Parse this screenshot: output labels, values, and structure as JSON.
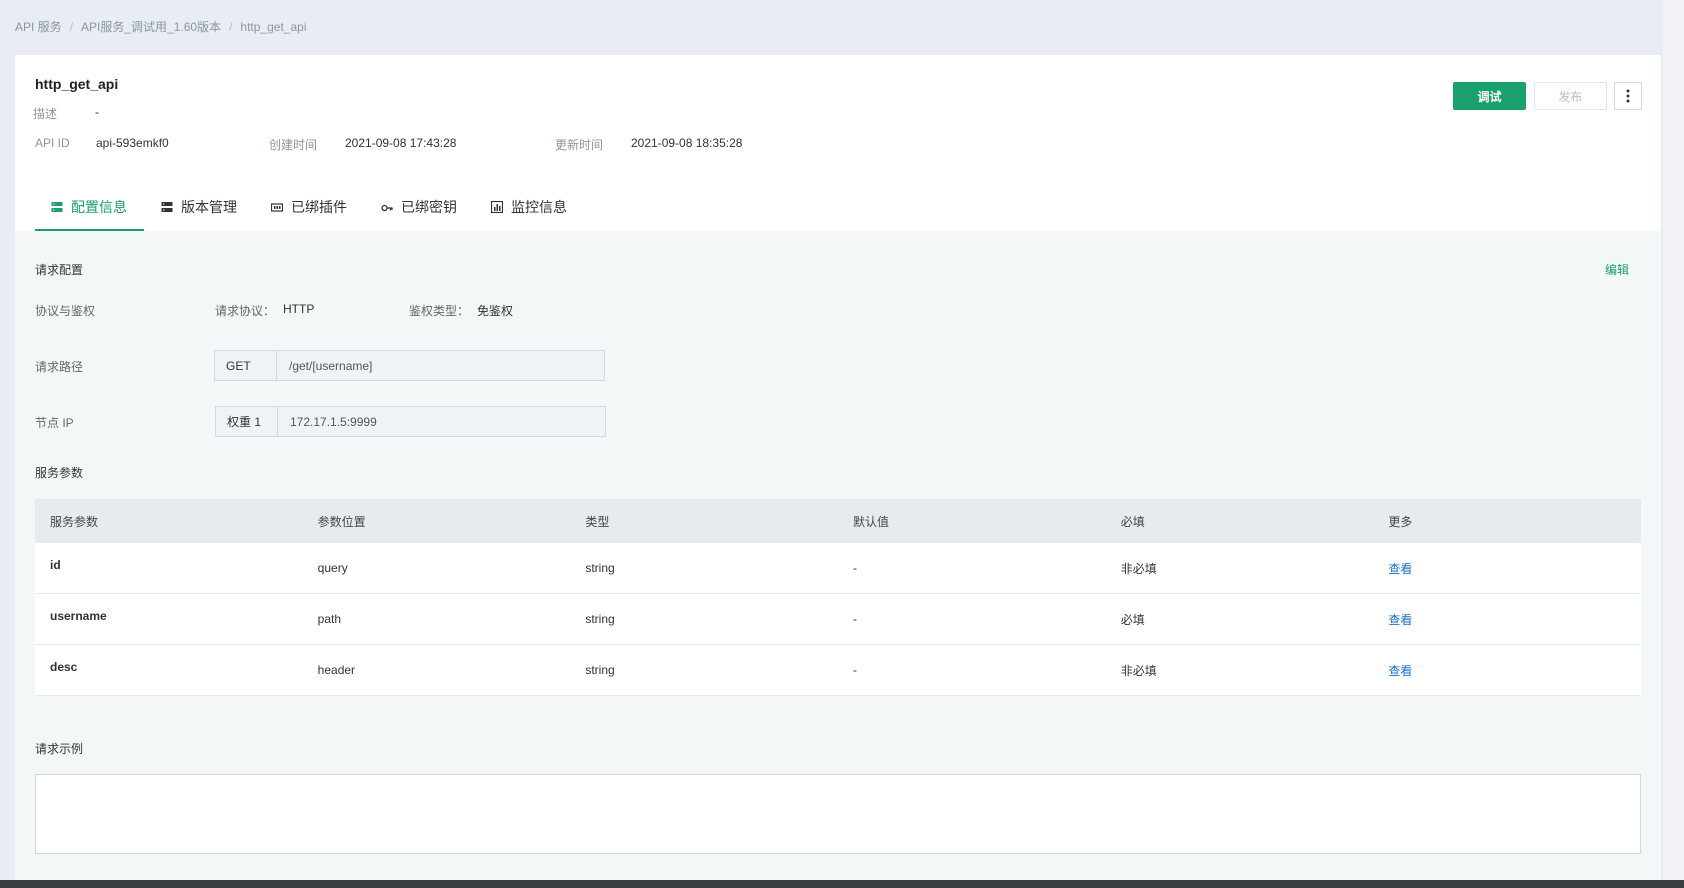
{
  "breadcrumb": {
    "items": [
      "API 服务",
      "API服务_调试用_1.60版本",
      "http_get_api"
    ],
    "separator": "/"
  },
  "header": {
    "title": "http_get_api",
    "desc_label": "描述",
    "desc_value": "-",
    "api_id_label": "API ID",
    "api_id_value": "api-593emkf0",
    "created_label": "创建时间",
    "created_value": "2021-09-08 17:43:28",
    "updated_label": "更新时间",
    "updated_value": "2021-09-08 18:35:28",
    "debug_button": "调试",
    "publish_button": "发布"
  },
  "tabs": [
    {
      "label": "配置信息",
      "icon": "server-icon",
      "active": true
    },
    {
      "label": "版本管理",
      "icon": "server-icon",
      "active": false
    },
    {
      "label": "已绑插件",
      "icon": "plugin-icon",
      "active": false
    },
    {
      "label": "已绑密钥",
      "icon": "key-icon",
      "active": false
    },
    {
      "label": "监控信息",
      "icon": "chart-icon",
      "active": false
    }
  ],
  "config": {
    "section_title": "请求配置",
    "edit_link": "编辑",
    "protocol_row_label": "协议与鉴权",
    "protocol_label": "请求协议：",
    "protocol_value": "HTTP",
    "auth_label": "鉴权类型：",
    "auth_value": "免鉴权",
    "path_label": "请求路径",
    "path_method": "GET",
    "path_value": "/get/[username]",
    "node_label": "节点 IP",
    "node_weight": "权重 1",
    "node_value": "172.17.1.5:9999"
  },
  "params": {
    "section_title": "服务参数",
    "headers": [
      "服务参数",
      "参数位置",
      "类型",
      "默认值",
      "必填",
      "更多"
    ],
    "rows": [
      {
        "name": "id",
        "location": "query",
        "type": "string",
        "default": "-",
        "required": "非必填",
        "more": "查看"
      },
      {
        "name": "username",
        "location": "path",
        "type": "string",
        "default": "-",
        "required": "必填",
        "more": "查看"
      },
      {
        "name": "desc",
        "location": "header",
        "type": "string",
        "default": "-",
        "required": "非必填",
        "more": "查看"
      }
    ]
  },
  "example": {
    "section_title": "请求示例",
    "content": ""
  },
  "colors": {
    "accent": "#1aa06a",
    "link": "#1a73c8"
  }
}
